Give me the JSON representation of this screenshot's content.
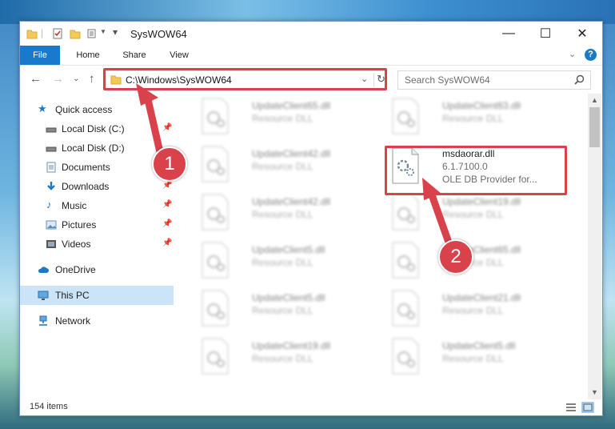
{
  "window": {
    "title": "SysWOW64",
    "minimize": "—",
    "maximize": "☐",
    "close": "✕"
  },
  "ribbon": {
    "tabs": [
      {
        "label": "File"
      },
      {
        "label": "Home"
      },
      {
        "label": "Share"
      },
      {
        "label": "View"
      }
    ],
    "help": "?"
  },
  "nav": {
    "address": "C:\\Windows\\SysWOW64",
    "search_placeholder": "Search SysWOW64"
  },
  "sidebar": {
    "items": [
      {
        "label": "Quick access",
        "icon": "star-icon"
      },
      {
        "label": "Local Disk (C:)",
        "icon": "drive-icon"
      },
      {
        "label": "Local Disk (D:)",
        "icon": "drive-icon"
      },
      {
        "label": "Documents",
        "icon": "documents-icon"
      },
      {
        "label": "Downloads",
        "icon": "download-icon"
      },
      {
        "label": "Music",
        "icon": "music-icon"
      },
      {
        "label": "Pictures",
        "icon": "pictures-icon"
      },
      {
        "label": "Videos",
        "icon": "videos-icon"
      },
      {
        "label": "OneDrive",
        "icon": "cloud-icon"
      },
      {
        "label": "This PC",
        "icon": "computer-icon"
      },
      {
        "label": "Network",
        "icon": "network-icon"
      }
    ]
  },
  "files": [
    {
      "name": "UpdateClient65.dll",
      "desc": "Resource DLL"
    },
    {
      "name": "UpdateClient63.dll",
      "desc": "Resource DLL"
    },
    {
      "name": "UpdateClient42.dll",
      "desc": "Resource DLL"
    },
    {
      "name": "msdaorar.dll",
      "version": "6.1.7100.0",
      "desc": "OLE DB Provider for..."
    },
    {
      "name": "UpdateClient42.dll",
      "desc": "Resource DLL"
    },
    {
      "name": "UpdateClient19.dll",
      "desc": "Resource DLL"
    },
    {
      "name": "UpdateClient5.dll",
      "desc": "Resource DLL"
    },
    {
      "name": "UpdateClient65.dll",
      "desc": "Resource DLL"
    },
    {
      "name": "UpdateClient5.dll",
      "desc": "Resource DLL"
    },
    {
      "name": "UpdateClient21.dll",
      "desc": "Resource DLL"
    },
    {
      "name": "UpdateClient19.dll",
      "desc": "Resource DLL"
    },
    {
      "name": "UpdateClient5.dll",
      "desc": "Resource DLL"
    }
  ],
  "status": {
    "item_count": "154 items"
  },
  "callouts": {
    "step1": "1",
    "step2": "2"
  },
  "colors": {
    "accent": "#1979ca",
    "highlight": "#d9414b",
    "selected": "#cce4f7"
  }
}
